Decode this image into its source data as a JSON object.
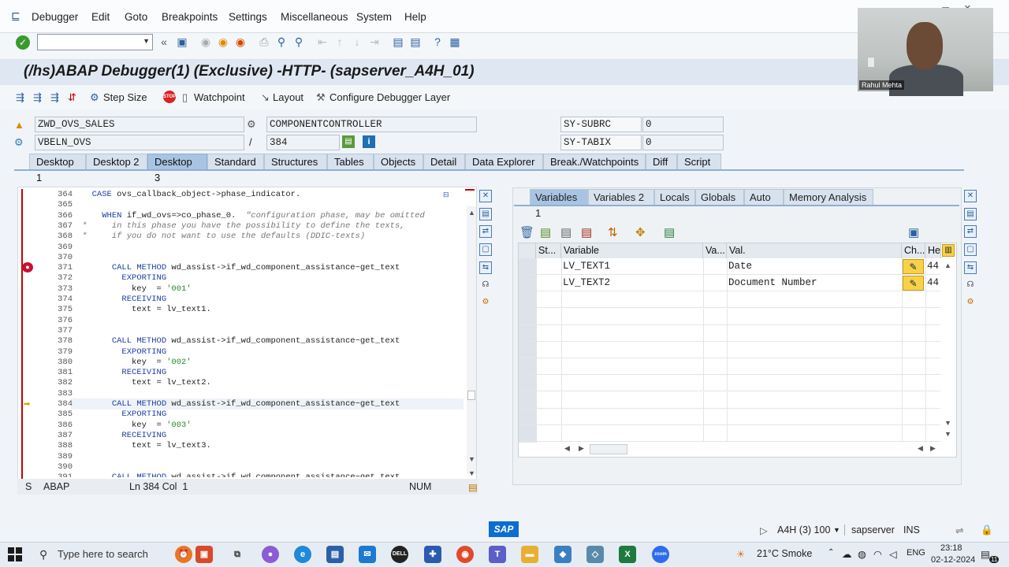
{
  "menubar": {
    "items": [
      "Debugger",
      "Edit",
      "Goto",
      "Breakpoints",
      "Settings",
      "Miscellaneous",
      "System",
      "Help"
    ]
  },
  "title": "(/hs)ABAP Debugger(1)  (Exclusive) -HTTP- (sapserver_A4H_01)",
  "debugger_toolbar": {
    "step_size": "Step Size",
    "watchpoint": "Watchpoint",
    "layout": "Layout",
    "configure": "Configure Debugger Layer"
  },
  "info": {
    "program": "ZWD_OVS_SALES",
    "component": "COMPONENTCONTROLLER",
    "method": "VBELN_OVS",
    "separator": "/",
    "line": "384",
    "sysubrc_label": "SY-SUBRC",
    "sysubrc_value": "0",
    "sytabix_label": "SY-TABIX",
    "sytabix_value": "0"
  },
  "tabs": [
    "Desktop 1",
    "Desktop 2",
    "Desktop 3",
    "Standard",
    "Structures",
    "Tables",
    "Objects",
    "Detail",
    "Data Explorer",
    "Break./Watchpoints",
    "Diff",
    "Script"
  ],
  "active_tab": "Desktop 3",
  "code_lines": [
    {
      "n": "364",
      "t": "  CASE ovs_callback_object->phase_indicator."
    },
    {
      "n": "365",
      "t": ""
    },
    {
      "n": "366",
      "t": "    WHEN if_wd_ovs=>co_phase_0.  \"configuration phase, may be omitted"
    },
    {
      "n": "367",
      "t": "*     in this phase you have the possibility to define the texts,"
    },
    {
      "n": "368",
      "t": "*     if you do not want to use the defaults (DDIC-texts)"
    },
    {
      "n": "369",
      "t": ""
    },
    {
      "n": "370",
      "t": ""
    },
    {
      "n": "371",
      "t": "      CALL METHOD wd_assist->if_wd_component_assistance~get_text"
    },
    {
      "n": "372",
      "t": "        EXPORTING"
    },
    {
      "n": "373",
      "t": "          key  = '001'"
    },
    {
      "n": "374",
      "t": "        RECEIVING"
    },
    {
      "n": "375",
      "t": "          text = lv_text1."
    },
    {
      "n": "376",
      "t": ""
    },
    {
      "n": "377",
      "t": ""
    },
    {
      "n": "378",
      "t": "      CALL METHOD wd_assist->if_wd_component_assistance~get_text"
    },
    {
      "n": "379",
      "t": "        EXPORTING"
    },
    {
      "n": "380",
      "t": "          key  = '002'"
    },
    {
      "n": "381",
      "t": "        RECEIVING"
    },
    {
      "n": "382",
      "t": "          text = lv_text2."
    },
    {
      "n": "383",
      "t": ""
    },
    {
      "n": "384",
      "t": "      CALL METHOD wd_assist->if_wd_component_assistance~get_text"
    },
    {
      "n": "385",
      "t": "        EXPORTING"
    },
    {
      "n": "386",
      "t": "          key  = '003'"
    },
    {
      "n": "387",
      "t": "        RECEIVING"
    },
    {
      "n": "388",
      "t": "          text = lv_text3."
    },
    {
      "n": "389",
      "t": ""
    },
    {
      "n": "390",
      "t": ""
    },
    {
      "n": "391",
      "t": "      CALL METHOD wd_assist->if_wd_component_assistance~get_text"
    }
  ],
  "status_bar": {
    "s": "S",
    "lang": "ABAP",
    "pos": "Ln 384 Col  1",
    "num": "NUM"
  },
  "var_tabs": [
    "Variables 1",
    "Variables 2",
    "Locals",
    "Globals",
    "Auto",
    "Memory Analysis"
  ],
  "grid": {
    "headers": [
      "St...",
      "Variable",
      "Va...",
      "Val.",
      "Ch...",
      "He"
    ],
    "rows": [
      {
        "variable": "LV_TEXT1",
        "value": "Date",
        "hex": "44"
      },
      {
        "variable": "LV_TEXT2",
        "value": "Document Number",
        "hex": "44"
      }
    ]
  },
  "webcam": {
    "name": "Rahul Mehta"
  },
  "sap_footer": {
    "logo": "SAP",
    "session": "A4H (3) 100",
    "server": "sapserver",
    "mode": "INS"
  },
  "taskbar": {
    "search_placeholder": "Type here to search",
    "weather": "21°C  Smoke",
    "lang": "ENG",
    "time": "23:18",
    "date": "02-12-2024",
    "notif_count": "11"
  },
  "colors": {
    "keyword": "#1c3da6",
    "comment": "#777777",
    "string": "#2a8a2a",
    "active_tab": "#a8c4e2",
    "breakpoint": "#c8102e"
  }
}
